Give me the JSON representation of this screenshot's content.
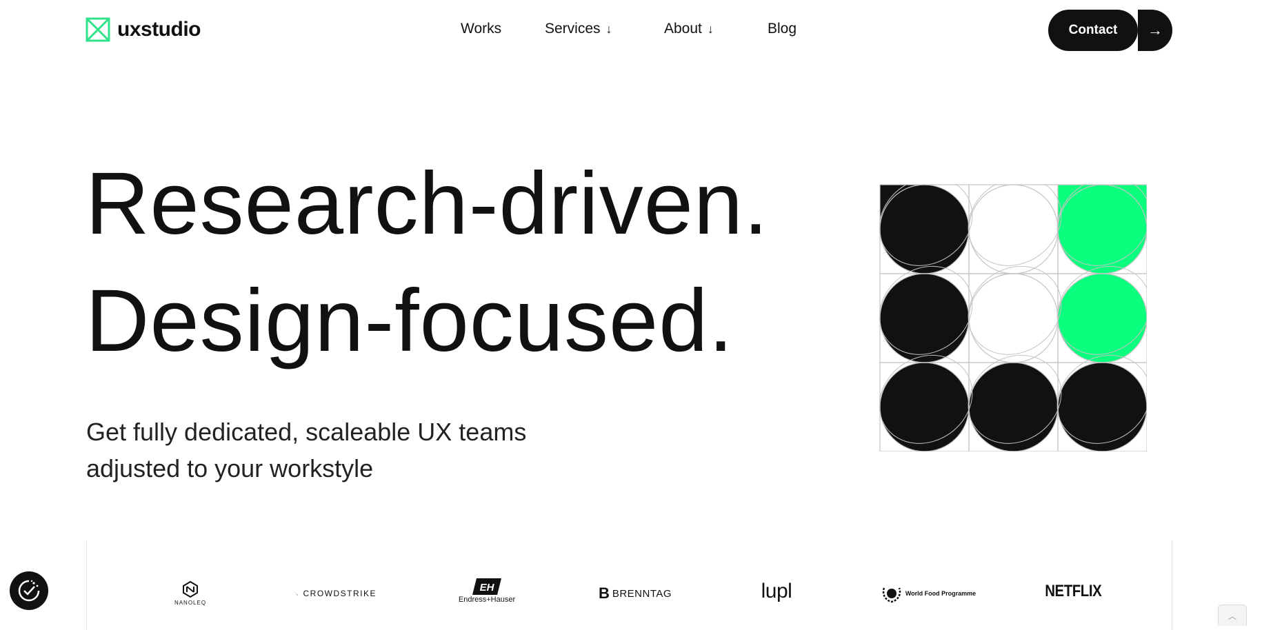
{
  "brand": {
    "name": "uxstudio",
    "accent": "#00FF7F",
    "dark": "#111111"
  },
  "nav": {
    "items": [
      {
        "label": "Works",
        "has_dropdown": false
      },
      {
        "label": "Services",
        "has_dropdown": true,
        "dropdown_icon": "arrow-down-icon"
      },
      {
        "label": "About",
        "has_dropdown": true,
        "dropdown_icon": "arrow-down-icon"
      },
      {
        "label": "Blog",
        "has_dropdown": false
      }
    ],
    "contact_label": "Contact",
    "contact_arrow_icon": "arrow-right-icon"
  },
  "hero": {
    "headline_line1": "Research-driven.",
    "headline_line2": "Design-focused.",
    "subtitle_line1": "Get fully dedicated, scaleable UX teams",
    "subtitle_line2": "adjusted to your workstyle"
  },
  "graphic": {
    "grid": [
      [
        "black",
        "white",
        "green"
      ],
      [
        "black",
        "white",
        "green"
      ],
      [
        "black",
        "black",
        "black"
      ]
    ],
    "colors": {
      "black": "#111111",
      "white": "#ffffff",
      "green": "#0AFF7E",
      "line": "#c4c4c4"
    }
  },
  "clients": [
    {
      "name": "NANOLEQ",
      "icon": "nanoleq-logo"
    },
    {
      "name": "CROWDSTRIKE",
      "icon": "crowdstrike-falcon-logo"
    },
    {
      "name": "Endress+Hauser",
      "icon": "endress-hauser-logo"
    },
    {
      "name": "BRENNTAG",
      "icon": "brenntag-logo"
    },
    {
      "name": "lupl",
      "icon": "lupl-logo"
    },
    {
      "name": "World Food Programme",
      "icon": "wfp-wreath-logo"
    },
    {
      "name": "NETFLIX",
      "icon": "netflix-logo"
    }
  ],
  "widgets": {
    "cookie_icon": "cookie-check-icon",
    "scroll_top_icon": "chevron-up-icon"
  }
}
